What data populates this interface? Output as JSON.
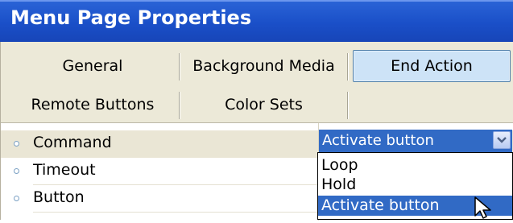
{
  "window": {
    "title": "Menu Page Properties"
  },
  "tabs": {
    "row1": [
      {
        "label": "General"
      },
      {
        "label": "Background Media"
      },
      {
        "label": "End Action",
        "active": true
      }
    ],
    "row2": [
      {
        "label": "Remote Buttons"
      },
      {
        "label": "Color Sets"
      }
    ]
  },
  "properties": [
    {
      "label": "Command"
    },
    {
      "label": "Timeout"
    },
    {
      "label": "Button"
    }
  ],
  "command_dropdown": {
    "selected": "Activate button",
    "options": [
      "Loop",
      "Hold",
      "Activate button"
    ],
    "highlighted_index": 2
  },
  "colors": {
    "title_bar": "#1a4fc8",
    "tab_area": "#ece9d8",
    "active_tab": "#cde3f7",
    "selection": "#316ac5"
  },
  "icons": {
    "dropdown": "chevron-down-icon",
    "cursor": "mouse-pointer-icon",
    "row_marker": "bullet-icon"
  }
}
